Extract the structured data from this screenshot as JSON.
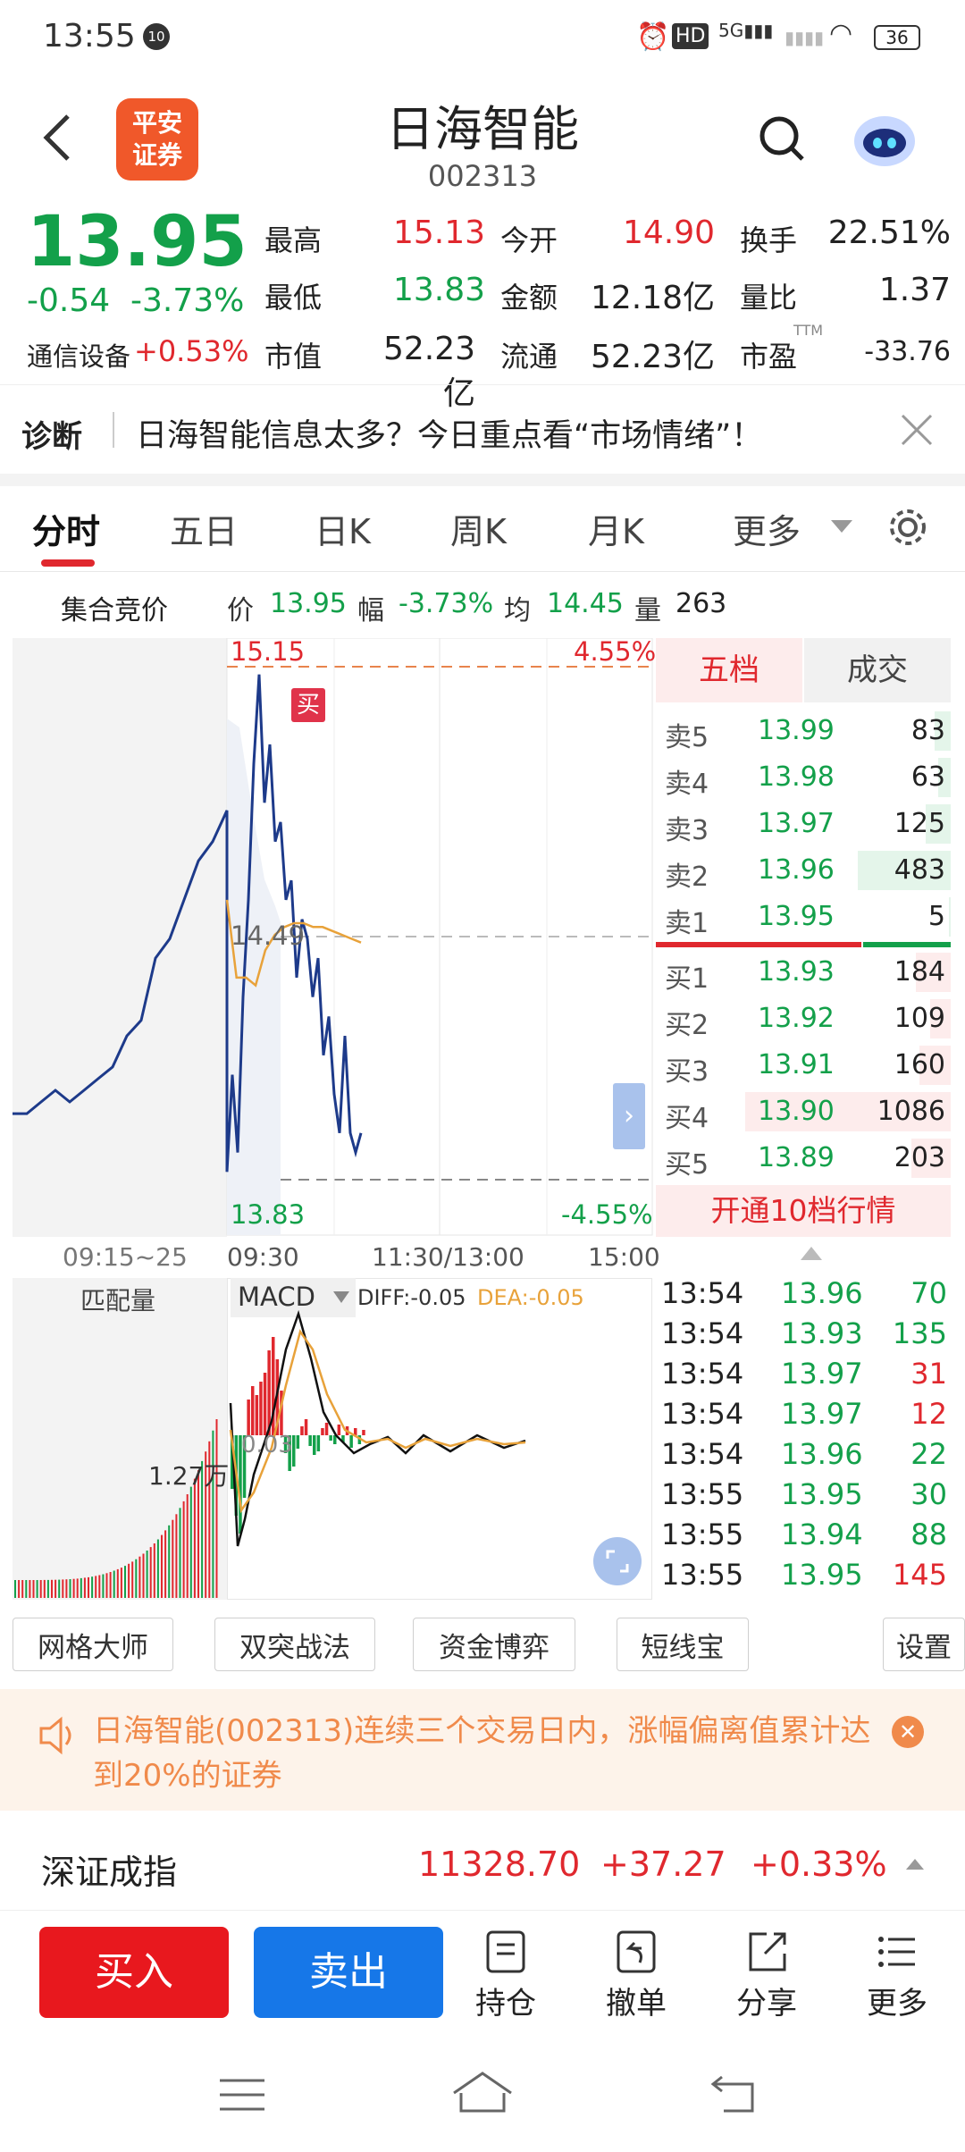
{
  "status_bar": {
    "time": "13:55",
    "battery": "36"
  },
  "header": {
    "logo_line1": "平安",
    "logo_line2": "证券",
    "title": "日海智能",
    "code": "002313"
  },
  "quote": {
    "price": "13.95",
    "change": "-0.54",
    "change_pct": "-3.73%",
    "sector_label": "通信设备",
    "sector_change": "+0.53%",
    "high_label": "最高",
    "high": "15.13",
    "open_label": "今开",
    "open": "14.90",
    "turnover_label": "换手",
    "turnover": "22.51%",
    "low_label": "最低",
    "low": "13.83",
    "amount_label": "金额",
    "amount": "12.18亿",
    "vol_ratio_label": "量比",
    "vol_ratio": "1.37",
    "mktcap_label": "市值",
    "mktcap": "52.23亿",
    "float_label": "流通",
    "float": "52.23亿",
    "pe_label": "市盈",
    "pe_sup": "TTM",
    "pe": "-33.76"
  },
  "diagnosis": {
    "label": "诊断",
    "text": "日海智能信息太多？今日重点看“市场情绪”！"
  },
  "tabs": {
    "items": [
      "分时",
      "五日",
      "日K",
      "周K",
      "月K",
      "更多"
    ]
  },
  "info_line": {
    "auction": "集合竞价",
    "price_label": "价",
    "price": "13.95",
    "range_label": "幅",
    "range": "-3.73%",
    "avg_label": "均",
    "avg": "14.45",
    "vol_label": "量",
    "vol": "263"
  },
  "chart_labels": {
    "top_price": "15.15",
    "top_pct": "4.55%",
    "mid_price": "14.49",
    "bottom_price": "13.83",
    "bottom_pct": "-4.55%",
    "buy_marker": "买",
    "t0": "09:15~25",
    "t1": "09:30",
    "t2": "11:30/13:00",
    "t3": "15:00",
    "match_vol": "匹配量",
    "indicator": "MACD",
    "diff": "DIFF:-0.05",
    "dea": "DEA:-0.05",
    "macd_zero": "0.03",
    "auction_vol": "1.27万"
  },
  "chart_data": {
    "type": "line",
    "title": "",
    "yrange": [
      13.83,
      15.15
    ],
    "series": [
      {
        "name": "",
        "values": [
          14.0,
          14.0,
          14.03,
          14.06,
          14.03,
          14.06,
          14.09,
          14.12,
          14.2,
          14.24,
          14.4,
          14.45,
          14.55,
          14.65,
          14.7,
          14.78,
          13.85,
          14.1,
          13.9,
          14.3,
          14.55,
          14.9,
          15.13,
          14.8,
          14.95,
          14.7,
          14.75,
          14.55,
          14.6,
          14.35,
          14.5,
          14.45,
          14.3,
          14.4,
          14.15,
          14.25,
          14.05,
          13.95,
          14.2,
          13.95,
          13.9,
          13.95
        ]
      },
      {
        "name": "",
        "values": [
          14.55,
          14.35,
          14.35,
          14.33,
          14.42,
          14.46,
          14.48,
          14.49,
          14.49,
          14.48,
          14.48,
          14.47,
          14.46,
          14.45,
          14.44
        ]
      }
    ]
  },
  "order_book": {
    "tab_5": "五档",
    "tab_trades": "成交",
    "asks": [
      {
        "label": "卖5",
        "price": "13.99",
        "vol": "83",
        "bar": 0.08
      },
      {
        "label": "卖4",
        "price": "13.98",
        "vol": "63",
        "bar": 0.06
      },
      {
        "label": "卖3",
        "price": "13.97",
        "vol": "125",
        "bar": 0.12
      },
      {
        "label": "卖2",
        "price": "13.96",
        "vol": "483",
        "bar": 0.45
      },
      {
        "label": "卖1",
        "price": "13.95",
        "vol": "5",
        "bar": 0.01
      }
    ],
    "bids": [
      {
        "label": "买1",
        "price": "13.93",
        "vol": "184",
        "bar": 0.17
      },
      {
        "label": "买2",
        "price": "13.92",
        "vol": "109",
        "bar": 0.1
      },
      {
        "label": "买3",
        "price": "13.91",
        "vol": "160",
        "bar": 0.15
      },
      {
        "label": "买4",
        "price": "13.90",
        "vol": "1086",
        "bar": 1.0
      },
      {
        "label": "买5",
        "price": "13.89",
        "vol": "203",
        "bar": 0.19
      }
    ],
    "open_10": "开通10档行情"
  },
  "trades": [
    {
      "time": "13:54",
      "price": "13.96",
      "vol": "70",
      "dir": "green"
    },
    {
      "time": "13:54",
      "price": "13.93",
      "vol": "135",
      "dir": "green"
    },
    {
      "time": "13:54",
      "price": "13.97",
      "vol": "31",
      "dir": "red"
    },
    {
      "time": "13:54",
      "price": "13.97",
      "vol": "12",
      "dir": "red"
    },
    {
      "time": "13:54",
      "price": "13.96",
      "vol": "22",
      "dir": "green"
    },
    {
      "time": "13:55",
      "price": "13.95",
      "vol": "30",
      "dir": "green"
    },
    {
      "time": "13:55",
      "price": "13.94",
      "vol": "88",
      "dir": "green"
    },
    {
      "time": "13:55",
      "price": "13.95",
      "vol": "145",
      "dir": "red"
    }
  ],
  "func_buttons": {
    "b1": "网格大师",
    "b2": "双突战法",
    "b3": "资金博弈",
    "b4": "短线宝",
    "b5": "设置"
  },
  "notice": {
    "text": "日海智能(002313)连续三个交易日内，涨幅偏离值累计达到20%的证券"
  },
  "index": {
    "name": "深证成指",
    "value": "11328.70",
    "change": "+37.27",
    "pct": "+0.33%"
  },
  "actions": {
    "buy": "买入",
    "sell": "卖出",
    "hold": "持仓",
    "cancel": "撤单",
    "share": "分享",
    "more": "更多"
  },
  "colors": {
    "up": "#e0282e",
    "down": "#13a04a",
    "accent_blue": "#1677e8",
    "price_line": "#1d3a8a",
    "avg_line": "#e8a23a"
  }
}
